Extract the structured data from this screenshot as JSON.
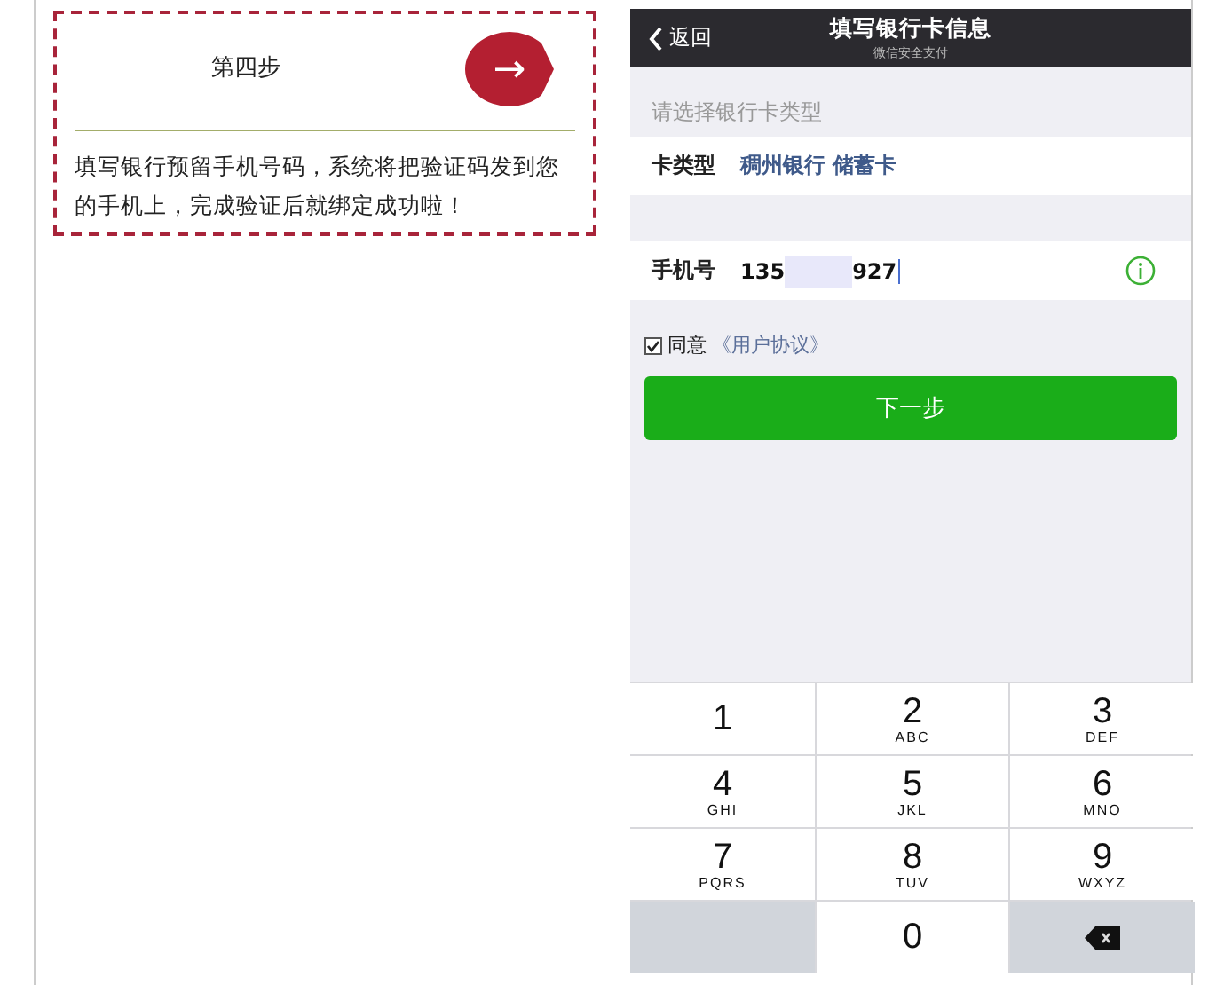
{
  "step_card": {
    "title": "第四步",
    "arrow": "→",
    "description": "填写银行预留手机号码，系统将把验证码发到您的手机上，完成验证后就绑定成功啦！"
  },
  "phone": {
    "nav": {
      "back": "返回",
      "title": "填写银行卡信息",
      "subtitle": "微信安全支付"
    },
    "section_hint": "请选择银行卡类型",
    "card_type": {
      "label": "卡类型",
      "value": "稠州银行 储蓄卡"
    },
    "mobile": {
      "label": "手机号",
      "prefix": "135",
      "suffix": "927"
    },
    "agreement": {
      "checked": true,
      "text": "同意",
      "link": "《用户协议》"
    },
    "next_button": "下一步",
    "keypad": [
      {
        "kind": "digit",
        "digit": "1"
      },
      {
        "kind": "digit",
        "digit": "2",
        "letters": "ABC"
      },
      {
        "kind": "digit",
        "digit": "3",
        "letters": "DEF"
      },
      {
        "kind": "digit",
        "digit": "4",
        "letters": "GHI"
      },
      {
        "kind": "digit",
        "digit": "5",
        "letters": "JKL"
      },
      {
        "kind": "digit",
        "digit": "6",
        "letters": "MNO"
      },
      {
        "kind": "digit",
        "digit": "7",
        "letters": "PQRS"
      },
      {
        "kind": "digit",
        "digit": "8",
        "letters": "TUV"
      },
      {
        "kind": "digit",
        "digit": "9",
        "letters": "WXYZ"
      },
      {
        "kind": "blank"
      },
      {
        "kind": "digit",
        "digit": "0"
      },
      {
        "kind": "delete"
      }
    ]
  }
}
